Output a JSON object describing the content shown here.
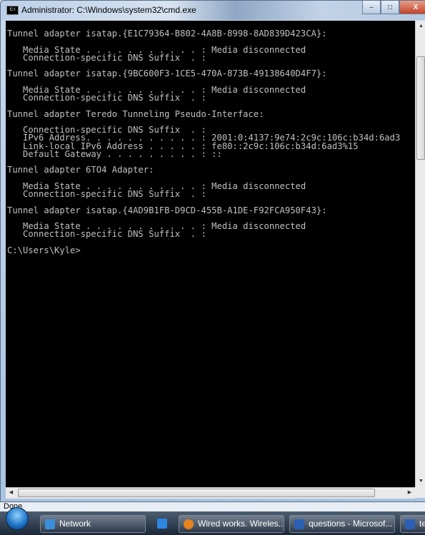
{
  "window": {
    "title": "Administrator: C:\\Windows\\system32\\cmd.exe",
    "app_icon_text": "C:\\",
    "controls": {
      "minimize": "–",
      "maximize": "□",
      "close": "X"
    }
  },
  "console": {
    "lines": [
      "Tunnel adapter isatap.{E1C79364-B802-4A8B-8998-8AD839D423CA}:",
      "",
      "   Media State . . . . . . . . . . . : Media disconnected",
      "   Connection-specific DNS Suffix  . :",
      "",
      "Tunnel adapter isatap.{9BC600F3-1CE5-470A-873B-49138640D4F7}:",
      "",
      "   Media State . . . . . . . . . . . : Media disconnected",
      "   Connection-specific DNS Suffix  . :",
      "",
      "Tunnel adapter Teredo Tunneling Pseudo-Interface:",
      "",
      "   Connection-specific DNS Suffix  . :",
      "   IPv6 Address. . . . . . . . . . . : 2001:0:4137:9e74:2c9c:106c:b34d:6ad3",
      "   Link-local IPv6 Address . . . . . : fe80::2c9c:106c:b34d:6ad3%15",
      "   Default Gateway . . . . . . . . . : ::",
      "",
      "Tunnel adapter 6TO4 Adapter:",
      "",
      "   Media State . . . . . . . . . . . : Media disconnected",
      "   Connection-specific DNS Suffix  . :",
      "",
      "Tunnel adapter isatap.{4AD9B1FB-D9CD-455B-A1DE-F92FCA950F43}:",
      "",
      "   Media State . . . . . . . . . . . : Media disconnected",
      "   Connection-specific DNS Suffix  . :",
      "",
      "C:\\Users\\Kyle>"
    ]
  },
  "browser_status": "Done",
  "taskbar": {
    "items": [
      {
        "label": "Network",
        "icon": "network-icon"
      },
      {
        "label": "",
        "icon": "media-player-icon"
      },
      {
        "label": "Wired works. Wireles...",
        "icon": "firefox-icon"
      },
      {
        "label": "questions - Microsof...",
        "icon": "word-icon"
      },
      {
        "label": "ter",
        "icon": "word-icon"
      }
    ]
  }
}
